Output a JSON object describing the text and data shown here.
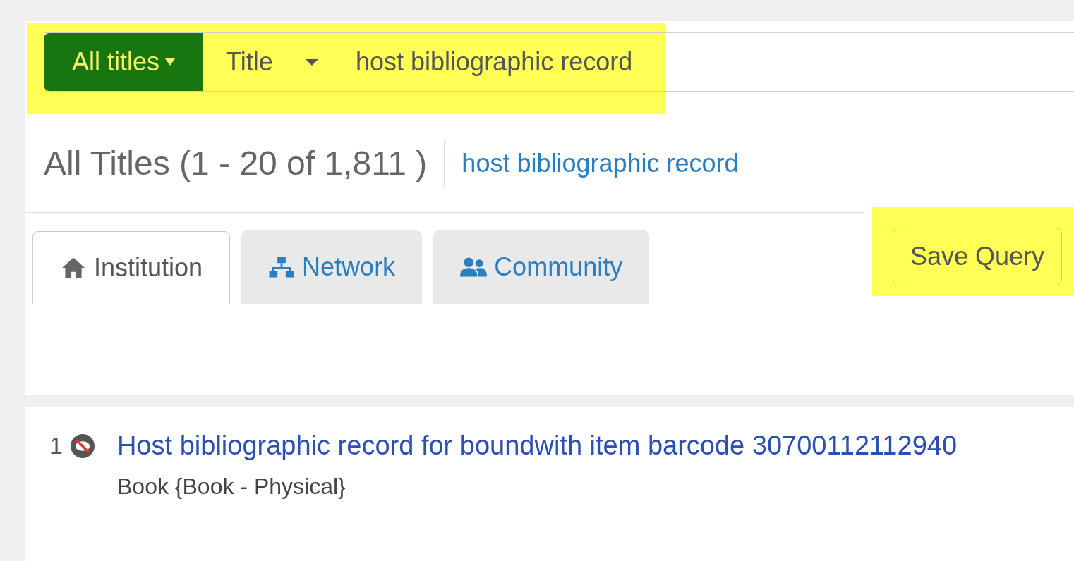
{
  "search_bar": {
    "highlighted": true,
    "scope_button": "All titles",
    "field_dropdown": "Title",
    "query": "host bibliographic record"
  },
  "results_header": {
    "title": "All Titles (1 - 20 of 1,811 )",
    "query_link": "host bibliographic record"
  },
  "tabs": [
    {
      "label": "Institution",
      "kind": "home",
      "selected": true
    },
    {
      "label": "Network",
      "kind": "network",
      "selected": false
    },
    {
      "label": "Community",
      "kind": "users",
      "selected": false
    }
  ],
  "save_query": {
    "label": "Save Query",
    "highlighted": true
  },
  "results": [
    {
      "number": "1",
      "title": "Host bibliographic record for boundwith item barcode 30700112112940",
      "type": "Book {Book - Physical}"
    }
  ]
}
